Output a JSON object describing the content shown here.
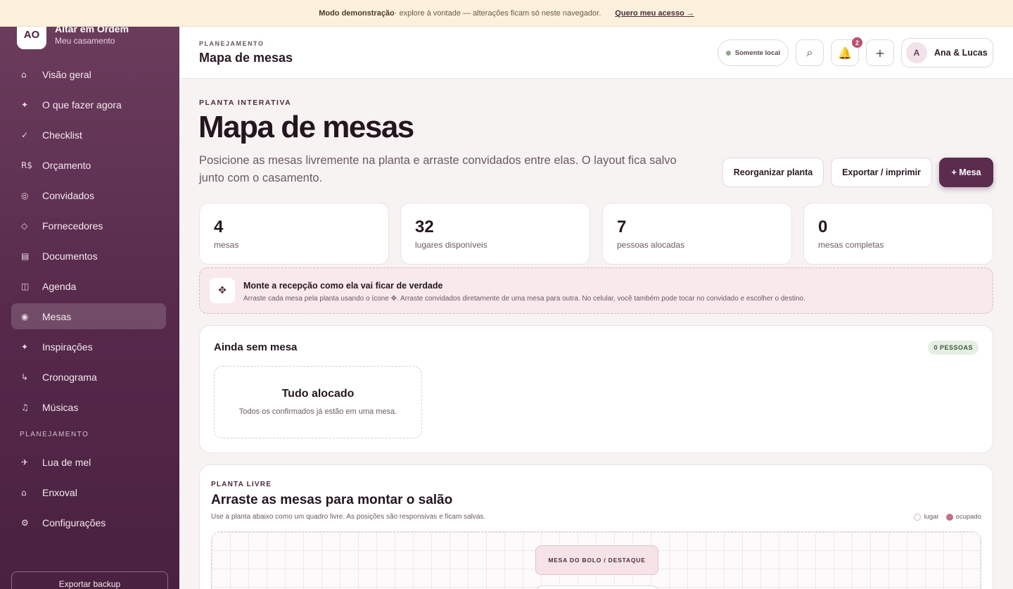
{
  "demo_bar": {
    "bold": "Modo demonstração",
    "text": " · explore à vontade — alterações ficam só neste navegador.",
    "link": "Quero meu acesso →"
  },
  "brand": {
    "logo": "AO",
    "name": "Altar em Ordem",
    "subtitle": "Meu casamento"
  },
  "nav": {
    "items": [
      {
        "icon": "⌂",
        "label": "Visão geral"
      },
      {
        "icon": "✦",
        "label": "O que fazer agora"
      },
      {
        "icon": "✓",
        "label": "Checklist"
      },
      {
        "icon": "R$",
        "label": "Orçamento"
      },
      {
        "icon": "◎",
        "label": "Convidados"
      },
      {
        "icon": "◇",
        "label": "Fornecedores"
      },
      {
        "icon": "▤",
        "label": "Documentos"
      },
      {
        "icon": "◫",
        "label": "Agenda"
      },
      {
        "icon": "◉",
        "label": "Mesas",
        "active": true
      },
      {
        "icon": "✦",
        "label": "Inspirações"
      },
      {
        "icon": "↳",
        "label": "Cronograma"
      },
      {
        "icon": "♫",
        "label": "Músicas"
      }
    ],
    "section_label": "PLANEJAMENTO",
    "planning_items": [
      {
        "icon": "✈",
        "label": "Lua de mel"
      },
      {
        "icon": "⌂",
        "label": "Enxoval"
      },
      {
        "icon": "⚙",
        "label": "Configurações"
      }
    ],
    "export_label": "Exportar backup"
  },
  "topbar": {
    "crumb": "PLANEJAMENTO",
    "title": "Mapa de mesas",
    "local_label": "Somente local",
    "search_icon": "⌕",
    "bell_icon": "🔔",
    "notifications_count": "2",
    "add_icon": "+",
    "avatar_initial": "A",
    "user_name": "Ana & Lucas"
  },
  "hero": {
    "eyebrow": "PLANTA INTERATIVA",
    "title": "Mapa de mesas",
    "description": "Posicione as mesas livremente na planta e arraste convidados entre elas. O layout fica salvo junto com o casamento.",
    "btn_reorganize": "Reorganizar planta",
    "btn_export": "Exportar / imprimir",
    "btn_add": "+ Mesa"
  },
  "stats": [
    {
      "value": "4",
      "label": "mesas"
    },
    {
      "value": "32",
      "label": "lugares disponíveis"
    },
    {
      "value": "7",
      "label": "pessoas alocadas"
    },
    {
      "value": "0",
      "label": "mesas completas"
    }
  ],
  "tip": {
    "icon": "✥",
    "title": "Monte a recepção como ela vai ficar de verdade",
    "text": "Arraste cada mesa pela planta usando o ícone ✥. Arraste convidados diretamente de uma mesa para outra. No celular, você também pode tocar no convidado e escolher o destino."
  },
  "unseated": {
    "title": "Ainda sem mesa",
    "count": "0 PESSOAS",
    "empty_title": "Tudo alocado",
    "empty_text": "Todos os confirmados já estão em uma mesa."
  },
  "plan": {
    "eyebrow": "PLANTA LIVRE",
    "title": "Arraste as mesas para montar o salão",
    "description": "Use a planta abaixo como um quadro livre. As posições são responsivas e ficam salvas.",
    "legend_free": "lugar",
    "legend_taken": "ocupado",
    "cake_label": "MESA DO BOLO / DESTAQUE"
  }
}
